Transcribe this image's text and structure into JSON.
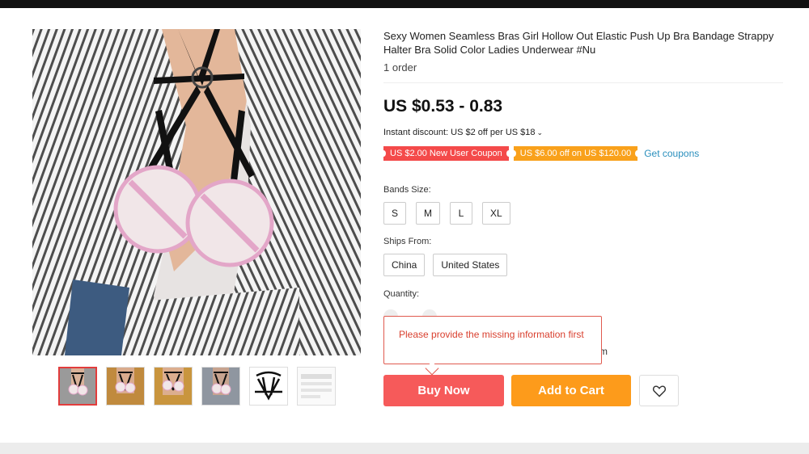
{
  "product": {
    "title": "Sexy Women Seamless Bras Girl Hollow Out Elastic Push Up Bra Bandage Strappy Halter Bra Solid Color Ladies Underwear #Nu",
    "orders": "1 order",
    "price": "US $0.53 - 0.83",
    "instant_discount": "Instant discount: US $2 off per US $18",
    "coupons": [
      "US $2.00 New User Coupon",
      "US $6.00 off on US $120.00"
    ],
    "get_coupons": "Get coupons"
  },
  "options": {
    "bands_label": "Bands Size:",
    "bands": [
      "S",
      "M",
      "L",
      "XL"
    ],
    "ships_label": "Ships From:",
    "ships": [
      "China",
      "United States"
    ],
    "quantity_label": "Quantity:"
  },
  "tooltip": {
    "message": "Please provide the missing information first",
    "partial_text": "m"
  },
  "actions": {
    "buy_now": "Buy Now",
    "add_to_cart": "Add to Cart",
    "wishlist_icon": "heart-icon"
  },
  "colors": {
    "buy_now": "#f65a5a",
    "add_to_cart": "#fd9b1b",
    "coupon_red": "#f44a4a",
    "coupon_orange": "#f9a11b",
    "link": "#2a8fbd",
    "thumb_active_border": "#e23c3c"
  },
  "gallery": {
    "thumbnail_count": 6,
    "active_thumbnail": 1
  }
}
